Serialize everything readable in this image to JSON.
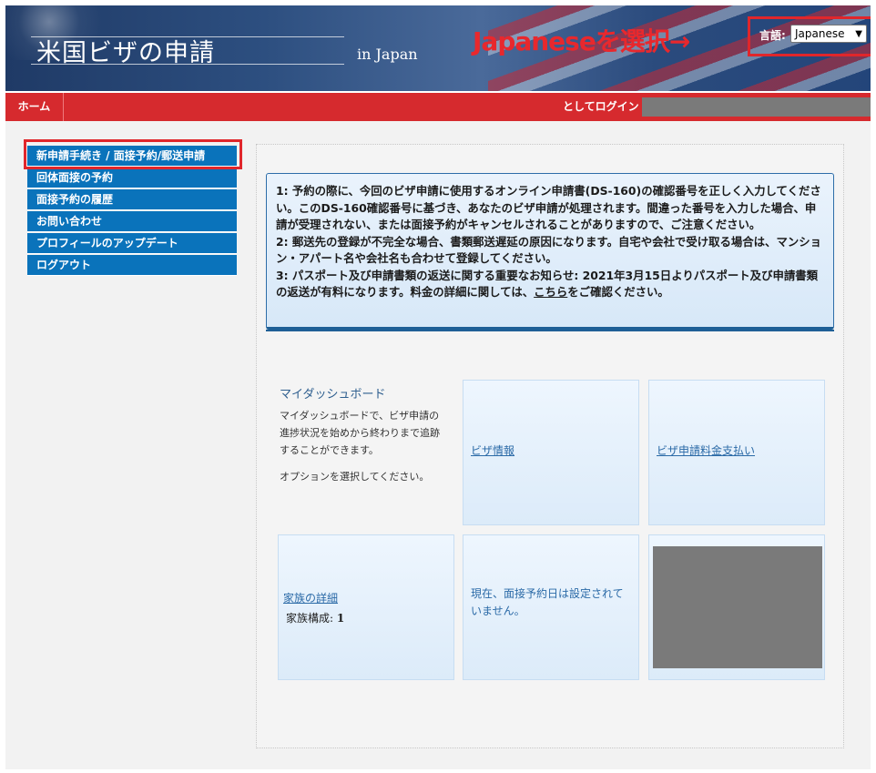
{
  "header": {
    "title": "米国ビザの申請",
    "subtitle": "in Japan",
    "annotation": "Japaneseを選択→",
    "language_label": "言語:",
    "language_selected": "Japanese"
  },
  "navbar": {
    "home": "ホーム",
    "login_label": "としてログイン"
  },
  "sidebar": {
    "items": [
      {
        "label": "新申請手続き / 面接予約/郵送申請"
      },
      {
        "label": "回体面接の予約"
      },
      {
        "label": "面接予約の履歴"
      },
      {
        "label": "お問い合わせ"
      },
      {
        "label": "プロフィールのアップデート"
      },
      {
        "label": "ログアウト"
      }
    ]
  },
  "notice": {
    "p1": "1: 予約の際に、今回のビザ申請に使用するオンライン申請書(DS-160)の確認番号を正しく入力してください。このDS-160確認番号に基づき、あなたのビザ申請が処理されます。間違った番号を入力した場合、申請が受理されない、または面接予約がキャンセルされることがありますので、ご注意ください。",
    "p2": "2: 郵送先の登録が不完全な場合、書類郵送遅延の原因になります。自宅や会社で受け取る場合は、マンション・アパート名や会社名も合わせて登録してください。",
    "p3_before": "3: パスポート及び申請書類の返送に関する重要なお知らせ: 2021年3月15日よりパスポート及び申請書類の返送が有料になります。料金の詳細に関しては、",
    "p3_link": "こちら",
    "p3_after": "をご確認ください。"
  },
  "dashboard": {
    "title": "マイダッシュボード",
    "description": "マイダッシュボードで、ビザ申請の進捗状況を始めから終わりまで追跡することができます。",
    "option_text": "オプションを選択してください。"
  },
  "tiles": {
    "visa_info": "ビザ情報",
    "visa_fee": "ビザ申請料金支払い",
    "family_details": "家族の詳細",
    "family_count_label": "家族構成:",
    "family_count_value": "1",
    "appointment_status": "現在、面接予約日は設定されていません。"
  },
  "colors": {
    "nav_red": "#d62a2e",
    "sidebar_blue": "#0a73bb",
    "annotation_red": "#e8282d",
    "link_blue": "#2b6aa7"
  }
}
